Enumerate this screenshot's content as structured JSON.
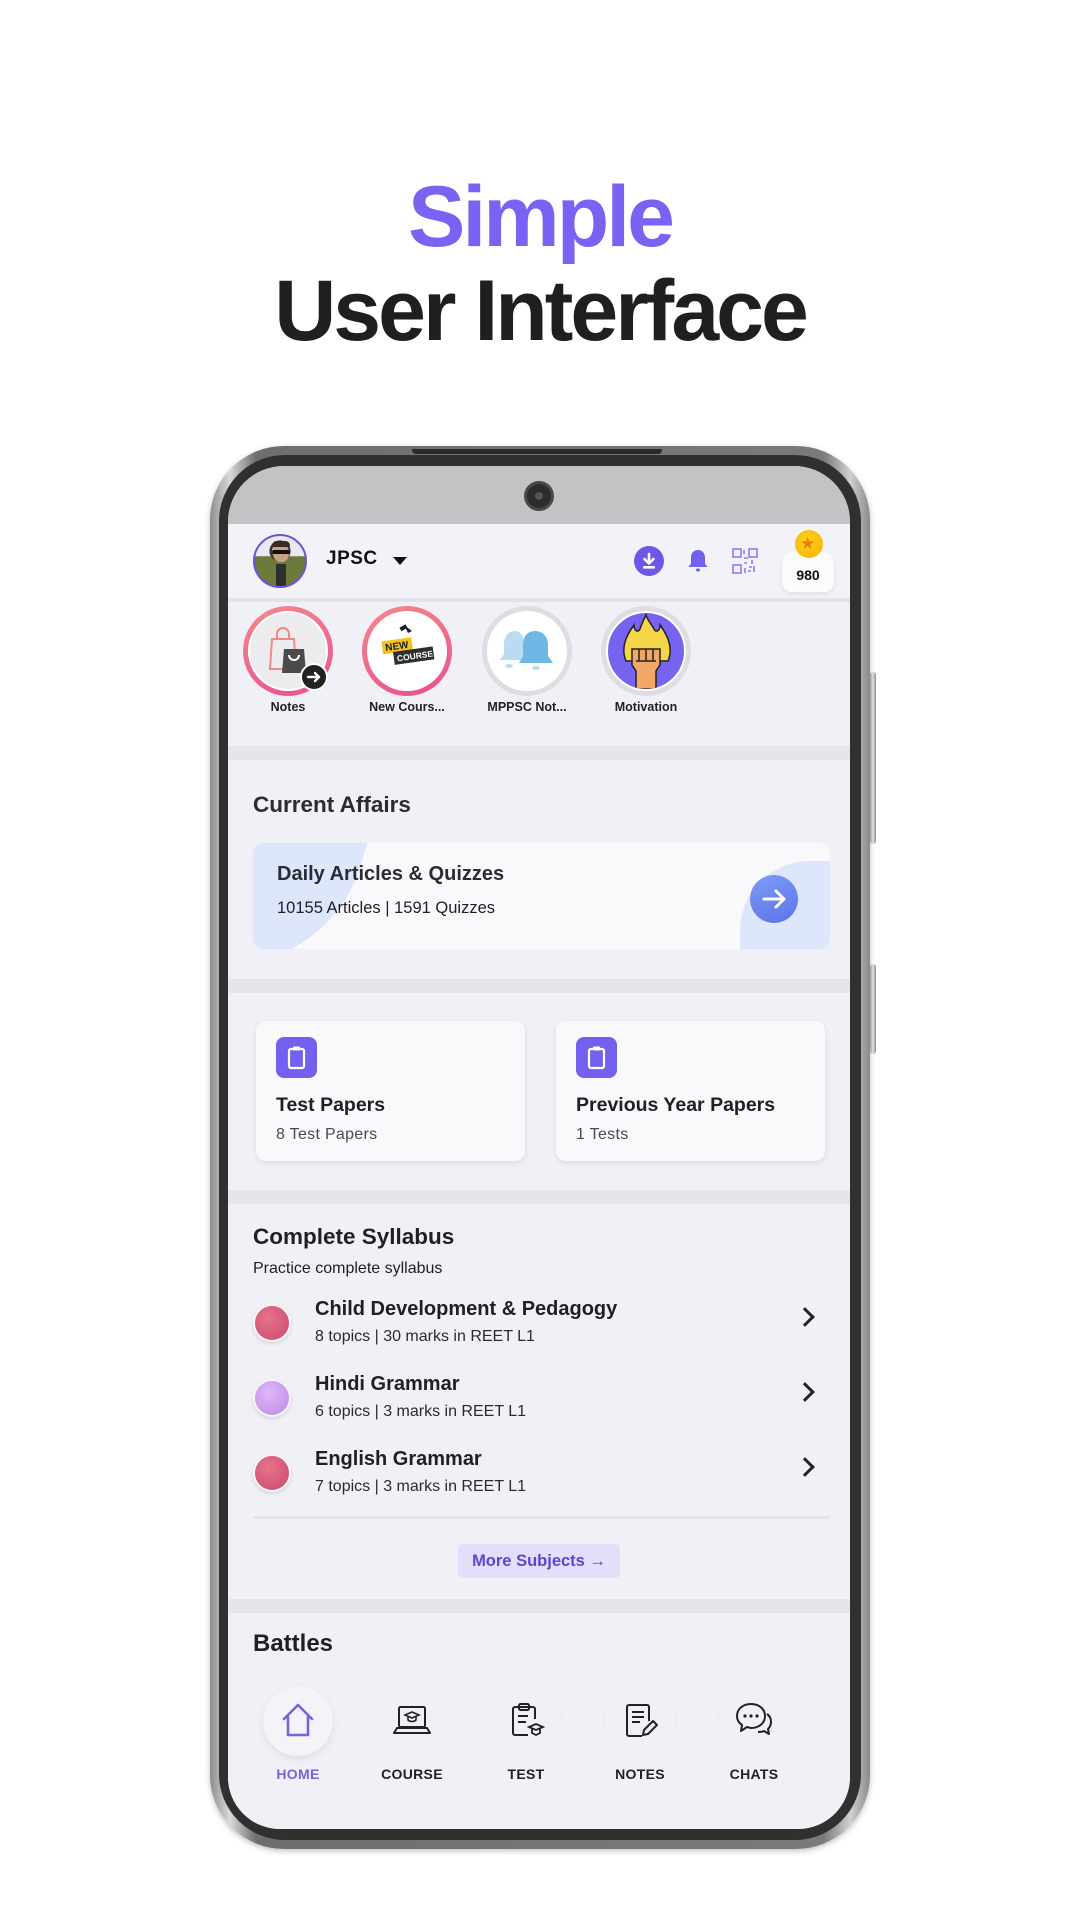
{
  "hero": {
    "line1": "Simple",
    "line2": "User Interface"
  },
  "colors": {
    "accent": "#7b62f2",
    "heading": "#1f1f1f",
    "screen_bg": "#f1f0f6",
    "active_nav": "#7a62d8"
  },
  "header": {
    "org_name": "JPSC",
    "coins": "980",
    "icons": [
      "download-icon",
      "bell-icon",
      "qr-code-icon",
      "coin-icon"
    ]
  },
  "stories": [
    {
      "label": "Notes",
      "icon": "shopping-bags-icon",
      "seen": false
    },
    {
      "label": "New Cours...",
      "icon": "new-course-icon",
      "seen": false
    },
    {
      "label": "MPPSC Not...",
      "icon": "bells-icon",
      "seen": true
    },
    {
      "label": "Motivation",
      "icon": "fist-icon",
      "seen": true
    }
  ],
  "current_affairs": {
    "section_title": "Current Affairs",
    "card_title": "Daily Articles & Quizzes",
    "card_subtitle": "10155 Articles | 1591 Quizzes"
  },
  "papers": [
    {
      "title": "Test Papers",
      "subtitle": "8 Test Papers"
    },
    {
      "title": "Previous Year Papers",
      "subtitle": "1 Tests"
    }
  ],
  "syllabus": {
    "title": "Complete Syllabus",
    "subtitle": "Practice complete syllabus",
    "subjects": [
      {
        "title": "Child Development & Pedagogy",
        "subtitle": "8 topics | 30 marks in REET L1"
      },
      {
        "title": "Hindi Grammar",
        "subtitle": "6 topics | 3 marks in REET L1"
      },
      {
        "title": "English Grammar",
        "subtitle": "7 topics | 3 marks in REET L1"
      }
    ],
    "more_button": "More Subjects →"
  },
  "battles": {
    "title": "Battles"
  },
  "nav": [
    {
      "label": "HOME",
      "icon": "home-icon",
      "active": true
    },
    {
      "label": "COURSE",
      "icon": "course-laptop-icon",
      "active": false
    },
    {
      "label": "TEST",
      "icon": "test-clipboard-icon",
      "active": false
    },
    {
      "label": "NOTES",
      "icon": "notes-icon",
      "active": false
    },
    {
      "label": "CHATS",
      "icon": "chats-icon",
      "active": false
    }
  ]
}
